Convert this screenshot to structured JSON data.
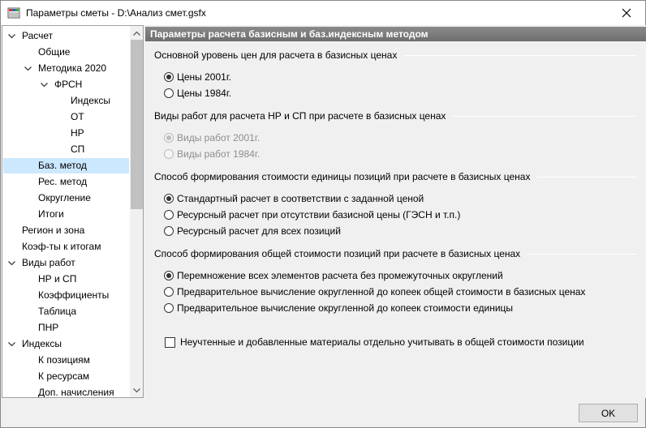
{
  "window": {
    "title": "Параметры сметы - D:\\Анализ смет.gsfx"
  },
  "tree": {
    "items": [
      {
        "label": "Расчет",
        "level": 0,
        "expanded": true
      },
      {
        "label": "Общие",
        "level": 1
      },
      {
        "label": "Методика 2020",
        "level": 1,
        "expanded": true
      },
      {
        "label": "ФРСН",
        "level": 2,
        "expanded": true
      },
      {
        "label": "Индексы",
        "level": 3
      },
      {
        "label": "ОТ",
        "level": 3
      },
      {
        "label": "НР",
        "level": 3
      },
      {
        "label": "СП",
        "level": 3
      },
      {
        "label": "Баз. метод",
        "level": 1,
        "selected": true
      },
      {
        "label": "Рес. метод",
        "level": 1
      },
      {
        "label": "Округление",
        "level": 1
      },
      {
        "label": "Итоги",
        "level": 1
      },
      {
        "label": "Регион и зона",
        "level": 0
      },
      {
        "label": "Коэф-ты к итогам",
        "level": 0
      },
      {
        "label": "Виды работ",
        "level": 0,
        "expanded": true
      },
      {
        "label": "НР и СП",
        "level": 1
      },
      {
        "label": "Коэффициенты",
        "level": 1
      },
      {
        "label": "Таблица",
        "level": 1
      },
      {
        "label": "ПНР",
        "level": 1
      },
      {
        "label": "Индексы",
        "level": 0,
        "expanded": true
      },
      {
        "label": "К позициям",
        "level": 1
      },
      {
        "label": "К ресурсам",
        "level": 1
      },
      {
        "label": "Доп. начисления",
        "level": 1
      }
    ]
  },
  "panel": {
    "header": "Параметры расчета базисным и баз.индексным методом",
    "groups": [
      {
        "title": "Основной уровень цен для расчета в базисных ценах",
        "options": [
          {
            "label": "Цены 2001г.",
            "checked": true,
            "disabled": false
          },
          {
            "label": "Цены 1984г.",
            "checked": false,
            "disabled": false
          }
        ]
      },
      {
        "title": "Виды работ для расчета НР и СП при расчете в базисных ценах",
        "options": [
          {
            "label": "Виды работ 2001г.",
            "checked": true,
            "disabled": true
          },
          {
            "label": "Виды работ 1984г.",
            "checked": false,
            "disabled": true
          }
        ]
      },
      {
        "title": "Способ формирования стоимости единицы позиций при расчете в базисных ценах",
        "options": [
          {
            "label": "Стандартный расчет в соответствии с заданной ценой",
            "checked": true,
            "disabled": false
          },
          {
            "label": "Ресурсный расчет при отсутствии базисной цены (ГЭСН и т.п.)",
            "checked": false,
            "disabled": false
          },
          {
            "label": "Ресурсный расчет для всех позиций",
            "checked": false,
            "disabled": false
          }
        ]
      },
      {
        "title": "Способ формирования общей стоимости позиций при расчете в базисных ценах",
        "options": [
          {
            "label": "Перемножение всех элементов расчета без промежуточных округлений",
            "checked": true,
            "disabled": false
          },
          {
            "label": "Предварительное вычисление округленной до копеек общей стоимости в базисных ценах",
            "checked": false,
            "disabled": false
          },
          {
            "label": "Предварительное вычисление округленной до копеек стоимости единицы",
            "checked": false,
            "disabled": false
          }
        ]
      }
    ],
    "checkbox": {
      "label": "Неучтенные и добавленные материалы отдельно учитывать в общей стоимости позиции",
      "checked": false
    }
  },
  "buttons": {
    "ok": "OK"
  }
}
